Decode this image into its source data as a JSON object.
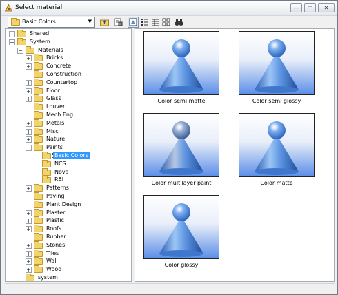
{
  "window": {
    "title": "Select material",
    "minimize_icon": "minimize-icon",
    "maximize_icon": "maximize-icon",
    "close_icon": "close-icon"
  },
  "toolbar": {
    "library_value": "Basic Colors",
    "buttons": [
      "folder-up-icon",
      "properties-icon",
      "view-thumbnails-icon",
      "view-list-icon",
      "view-details-icon",
      "find-icon"
    ]
  },
  "tree": [
    {
      "label": "Shared",
      "depth": 0,
      "expander": "+"
    },
    {
      "label": "System",
      "depth": 0,
      "expander": "-"
    },
    {
      "label": "Materials",
      "depth": 1,
      "expander": "-"
    },
    {
      "label": "Bricks",
      "depth": 2,
      "expander": "+"
    },
    {
      "label": "Concrete",
      "depth": 2,
      "expander": "+"
    },
    {
      "label": "Construction",
      "depth": 2,
      "expander": ""
    },
    {
      "label": "Countertop",
      "depth": 2,
      "expander": "+"
    },
    {
      "label": "Floor",
      "depth": 2,
      "expander": "+"
    },
    {
      "label": "Glass",
      "depth": 2,
      "expander": "+"
    },
    {
      "label": "Louver",
      "depth": 2,
      "expander": ""
    },
    {
      "label": "Mech Eng",
      "depth": 2,
      "expander": ""
    },
    {
      "label": "Metals",
      "depth": 2,
      "expander": "+"
    },
    {
      "label": "Misc",
      "depth": 2,
      "expander": "+"
    },
    {
      "label": "Nature",
      "depth": 2,
      "expander": "+"
    },
    {
      "label": "Paints",
      "depth": 2,
      "expander": "-"
    },
    {
      "label": "Basic Colors",
      "depth": 3,
      "expander": "",
      "selected": true
    },
    {
      "label": "NCS",
      "depth": 3,
      "expander": ""
    },
    {
      "label": "Nova",
      "depth": 3,
      "expander": ""
    },
    {
      "label": "RAL",
      "depth": 3,
      "expander": ""
    },
    {
      "label": "Patterns",
      "depth": 2,
      "expander": "+"
    },
    {
      "label": "Paving",
      "depth": 2,
      "expander": ""
    },
    {
      "label": "Plant Design",
      "depth": 2,
      "expander": ""
    },
    {
      "label": "Plaster",
      "depth": 2,
      "expander": "+"
    },
    {
      "label": "Plastic",
      "depth": 2,
      "expander": "+"
    },
    {
      "label": "Roofs",
      "depth": 2,
      "expander": "+"
    },
    {
      "label": "Rubber",
      "depth": 2,
      "expander": ""
    },
    {
      "label": "Stones",
      "depth": 2,
      "expander": "+"
    },
    {
      "label": "Tiles",
      "depth": 2,
      "expander": "+"
    },
    {
      "label": "Wall",
      "depth": 2,
      "expander": "+"
    },
    {
      "label": "Wood",
      "depth": 2,
      "expander": "+"
    },
    {
      "label": "system",
      "depth": 1,
      "expander": ""
    }
  ],
  "materials": [
    {
      "name": "Color semi matte",
      "sheen": "semi-matte"
    },
    {
      "name": "Color semi glossy",
      "sheen": "semi-glossy"
    },
    {
      "name": "Color multilayer paint",
      "sheen": "multilayer"
    },
    {
      "name": "Color matte",
      "sheen": "matte"
    },
    {
      "name": "Color glossy",
      "sheen": "glossy"
    }
  ],
  "colors": {
    "selection": "#3399ff",
    "material_blue": "#4f8fe0",
    "folder": "#f2d46f"
  }
}
